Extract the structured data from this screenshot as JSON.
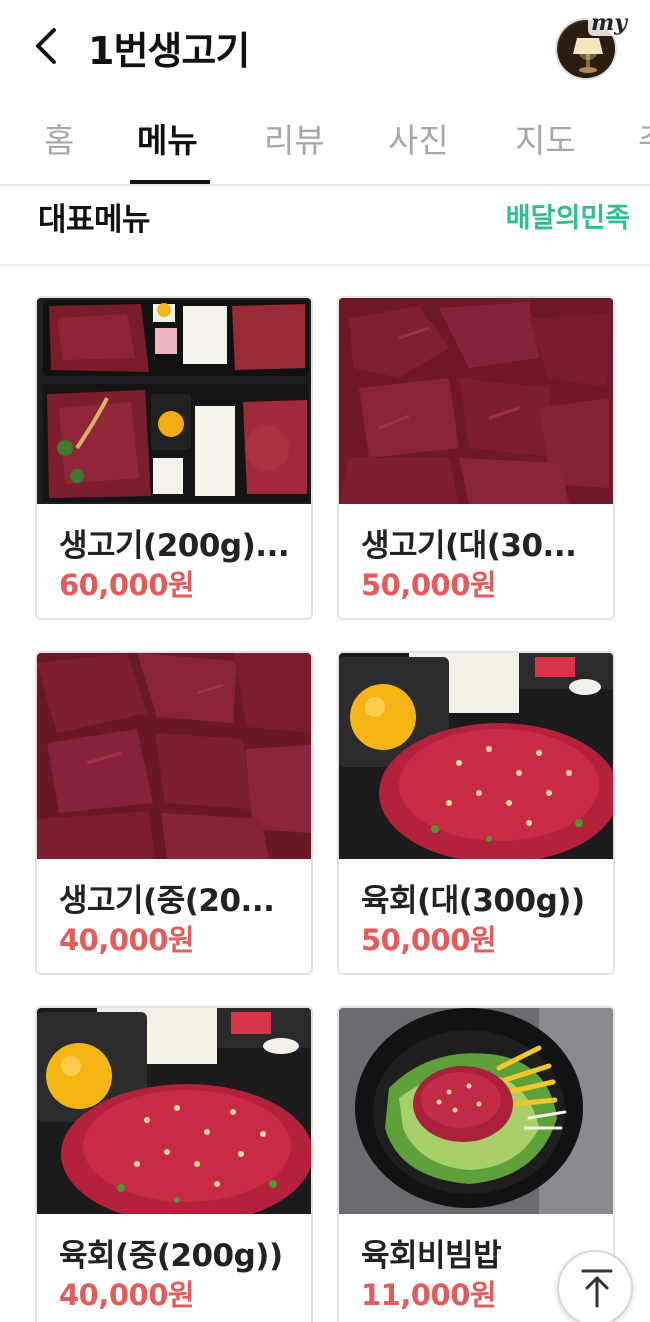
{
  "header": {
    "title": "1번생고기",
    "avatar_badge": "my"
  },
  "tabs": [
    {
      "label": "홈",
      "active": false
    },
    {
      "label": "메뉴",
      "active": true
    },
    {
      "label": "리뷰",
      "active": false
    },
    {
      "label": "사진",
      "active": false
    },
    {
      "label": "지도",
      "active": false
    },
    {
      "label": "주",
      "active": false
    }
  ],
  "section": {
    "title": "대표메뉴",
    "brand_link": "배달의민족"
  },
  "menu_items": [
    {
      "name": "생고기(200g)...",
      "price": "60,000원",
      "image": "platter-photo"
    },
    {
      "name": "생고기(대(30...",
      "price": "50,000원",
      "image": "raw-beef-photo"
    },
    {
      "name": "생고기(중(20...",
      "price": "40,000원",
      "image": "raw-beef-photo"
    },
    {
      "name": "육회(대(300g))",
      "price": "50,000원",
      "image": "yukhoe-photo"
    },
    {
      "name": "육회(중(200g))",
      "price": "40,000원",
      "image": "yukhoe-photo"
    },
    {
      "name": "육회비빔밥",
      "price": "11,000원",
      "image": "bibimbap-photo"
    }
  ],
  "colors": {
    "price": "#e45b5b",
    "brand": "#2bc08d",
    "active_tab": "#111111",
    "inactive_tab": "#a7a7a7"
  },
  "icons": [
    "back-arrow-icon",
    "scroll-to-top-icon"
  ]
}
